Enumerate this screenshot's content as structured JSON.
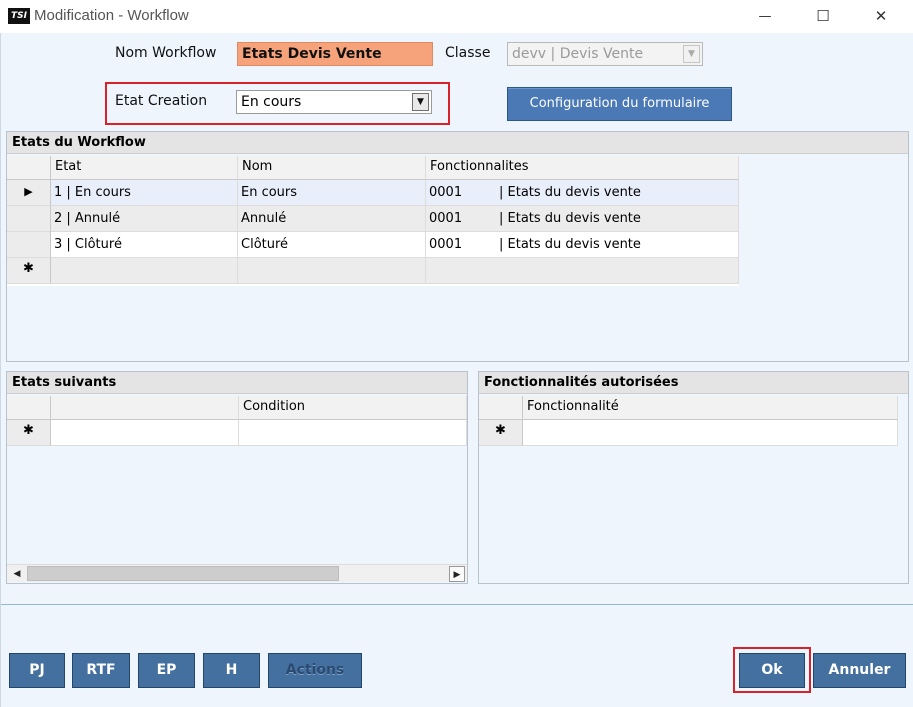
{
  "window": {
    "icon_text": "TSI",
    "title": "Modification - Workflow",
    "minimize_glyph": "—",
    "maximize_glyph": "☐",
    "close_glyph": "✕"
  },
  "form": {
    "nom_workflow_label": "Nom Workflow",
    "nom_workflow_value": "Etats Devis Vente",
    "classe_label": "Classe",
    "classe_value": "devv | Devis Vente",
    "etat_creation_label": "Etat Creation",
    "etat_creation_value": "En cours",
    "config_button": "Configuration du formulaire",
    "dropdown_arrow": "▼"
  },
  "etats_workflow": {
    "title": "Etats du Workflow",
    "columns": [
      "Etat",
      "Nom",
      "Fonctionnalites"
    ],
    "rows": [
      {
        "marker": "▶",
        "etat": "1 | En cours",
        "nom": "En cours",
        "code": "0001",
        "fonct": "| Etats du devis vente"
      },
      {
        "marker": "",
        "etat": "2 | Annulé",
        "nom": "Annulé",
        "code": "0001",
        "fonct": "| Etats du devis vente"
      },
      {
        "marker": "",
        "etat": "3 | Clôturé",
        "nom": "Clôturé",
        "code": "0001",
        "fonct": "| Etats du devis vente"
      }
    ],
    "new_row_marker": "✱"
  },
  "etats_suivants": {
    "title": "Etats suivants",
    "columns": [
      "",
      "Condition"
    ],
    "new_row_marker": "✱",
    "scroll_left": "◀",
    "scroll_right": "▶"
  },
  "fonctionnalites_autorisees": {
    "title": "Fonctionnalités autorisées",
    "columns": [
      "Fonctionnalité"
    ],
    "new_row_marker": "✱"
  },
  "bottom_buttons": {
    "pj": "PJ",
    "rtf": "RTF",
    "ep": "EP",
    "h": "H",
    "actions": "Actions",
    "ok": "Ok",
    "annuler": "Annuler"
  },
  "colors": {
    "accent_blue": "#4a79b6",
    "highlight_red": "#d8222a",
    "field_orange": "#f6a37c",
    "selected_row": "#e8eefa"
  }
}
